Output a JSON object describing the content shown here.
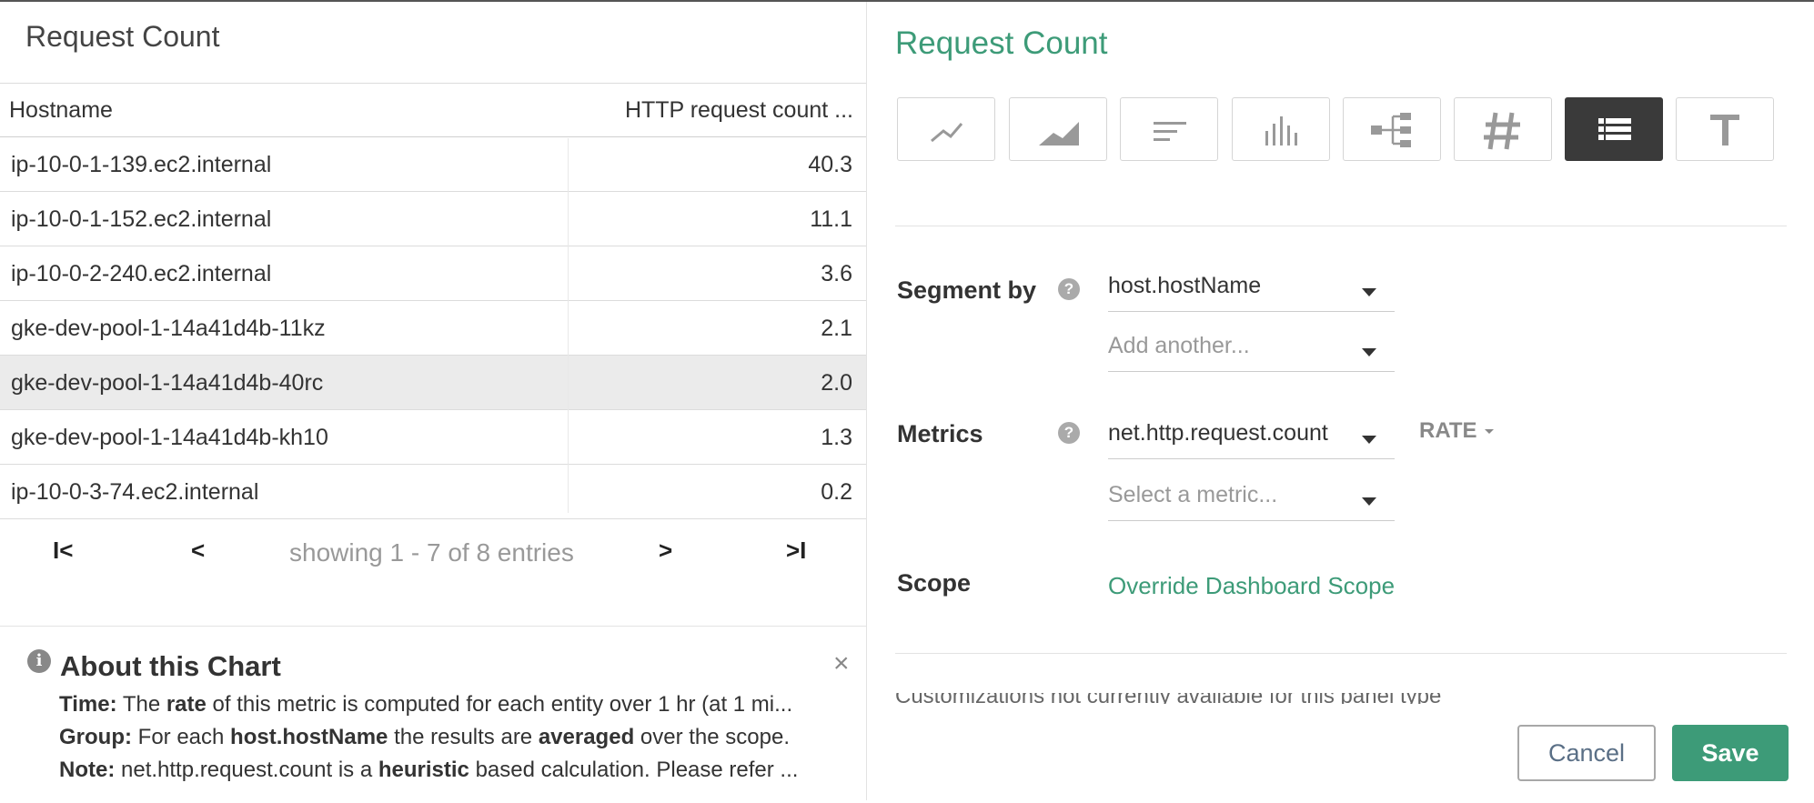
{
  "left_panel": {
    "title": "Request Count",
    "table": {
      "headers": [
        "Hostname",
        "HTTP request count ..."
      ],
      "rows": [
        {
          "host": "ip-10-0-1-139.ec2.internal",
          "value": "40.3"
        },
        {
          "host": "ip-10-0-1-152.ec2.internal",
          "value": "11.1"
        },
        {
          "host": "ip-10-0-2-240.ec2.internal",
          "value": "3.6"
        },
        {
          "host": "gke-dev-pool-1-14a41d4b-11kz",
          "value": "2.1"
        },
        {
          "host": "gke-dev-pool-1-14a41d4b-40rc",
          "value": "2.0"
        },
        {
          "host": "gke-dev-pool-1-14a41d4b-kh10",
          "value": "1.3"
        },
        {
          "host": "ip-10-0-3-74.ec2.internal",
          "value": "0.2"
        }
      ],
      "highlighted_row": 4
    },
    "pager": {
      "first": "I<",
      "prev": "<",
      "info": "showing 1 - 7 of 8 entries",
      "next": ">",
      "last": ">I"
    }
  },
  "about": {
    "icon": "info-icon",
    "title": "About this Chart",
    "close": "×",
    "time": {
      "label": "Time:",
      "pre": "The",
      "b1": "rate",
      "post": "of this metric is computed for each entity over 1 hr (at 1 mi..."
    },
    "group": {
      "label": "Group:",
      "pre": "For each",
      "b1": "host.hostName",
      "mid": "the results are",
      "b2": "averaged",
      "post": "over the scope."
    },
    "note": {
      "label": "Note:",
      "pre": "net.http.request.count is a",
      "b1": "heuristic",
      "post": "based calculation. Please refer ..."
    }
  },
  "editor": {
    "title": "Request Count",
    "viz_types": [
      "line-chart-icon",
      "area-chart-icon",
      "bar-chart-icon",
      "histogram-icon",
      "topology-icon",
      "number-icon",
      "table-icon",
      "text-icon"
    ],
    "active_viz": "table-icon",
    "segment_by": {
      "label": "Segment by",
      "help": "?",
      "value": "host.hostName",
      "add_placeholder": "Add another..."
    },
    "metrics": {
      "label": "Metrics",
      "help": "?",
      "value": "net.http.request.count",
      "aggregation": "RATE",
      "add_placeholder": "Select a metric..."
    },
    "scope": {
      "label": "Scope",
      "link": "Override Dashboard Scope"
    },
    "cut_text": "Customizations not currently available for this panel type",
    "buttons": {
      "cancel": "Cancel",
      "save": "Save"
    }
  },
  "colors": {
    "accent": "#3d9b78",
    "active_viz_bg": "#3a3a3a"
  }
}
